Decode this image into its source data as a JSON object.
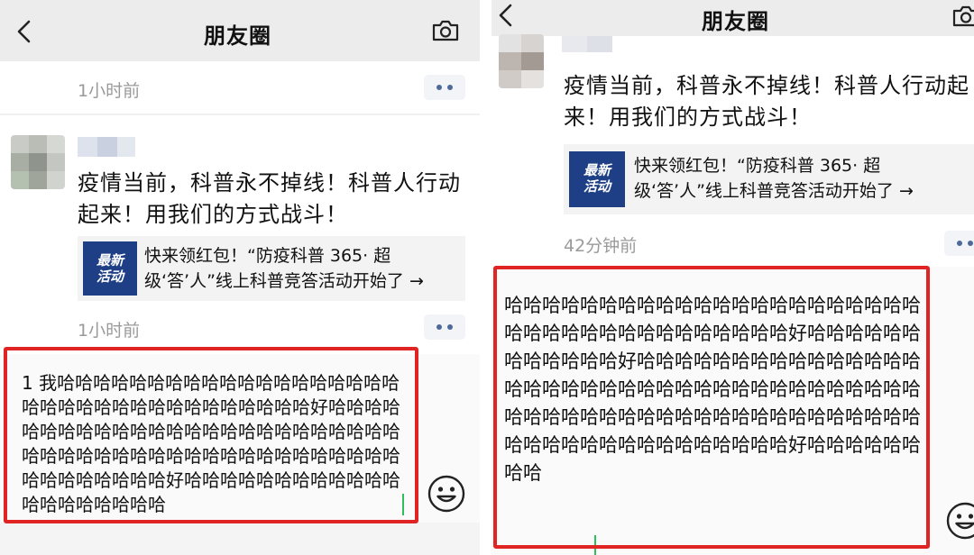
{
  "left": {
    "nav": {
      "title": "朋友圈"
    },
    "posts": [
      {
        "time": "1小时前"
      },
      {
        "text": "疫情当前，科普永不掉线！科普人行动起来！用我们的方式战斗！",
        "link": {
          "thumb_line1": "最新",
          "thumb_line2": "活动",
          "text": "快来领红包！“防疫科普 365· 超级‘答’人”线上科普竞答活动开始了 →"
        },
        "time": "1小时前"
      }
    ],
    "comment_input": {
      "value": "1 我哈哈哈哈哈哈哈哈哈哈哈哈哈哈哈哈哈哈哈哈哈哈哈哈哈哈哈哈哈哈哈哈哈哈哈好哈哈哈哈哈哈哈哈哈哈哈哈哈哈哈哈哈哈哈哈哈哈哈哈哈哈哈哈哈哈哈哈哈哈哈哈哈哈哈哈哈哈哈哈哈哈哈哈哈哈哈哈哈哈好哈哈哈哈哈哈哈哈哈哈哈哈哈哈哈哈哈哈哈哈"
    }
  },
  "right": {
    "nav": {
      "title": "朋友圈"
    },
    "post": {
      "text": "疫情当前，科普永不掉线！科普人行动起来！用我们的方式战斗！",
      "link": {
        "thumb_line1": "最新",
        "thumb_line2": "活动",
        "text": "快来领红包！“防疫科普 365· 超级‘答’人”线上科普竞答活动开始了 →"
      },
      "time": "42分钟前"
    },
    "comment_input": {
      "value": "哈哈哈哈哈哈哈哈哈哈哈哈哈哈哈哈哈哈哈哈哈哈哈哈哈哈哈哈哈哈哈哈哈哈哈哈哈好哈哈哈哈哈哈哈哈哈哈哈哈好哈哈哈哈哈哈哈哈哈哈哈哈哈哈哈哈哈哈哈哈哈哈哈哈哈哈哈哈哈哈哈哈哈哈哈哈哈哈哈哈哈哈哈哈哈哈哈哈哈哈哈哈哈哈哈哈哈哈哈哈哈哈哈哈哈哈哈哈哈哈哈哈哈哈好哈哈哈哈哈哈哈哈"
    }
  },
  "colors": {
    "highlight": "#e02424",
    "nav_bg": "#ececec",
    "time_text": "#9a9a9a",
    "more_dots": "#4e6a9a",
    "thumb_bg": "#1e3f86",
    "caret": "#2fbf5a"
  },
  "icons": [
    "chevron-left-icon",
    "camera-icon",
    "more-dots-icon",
    "emoji-face-icon"
  ]
}
